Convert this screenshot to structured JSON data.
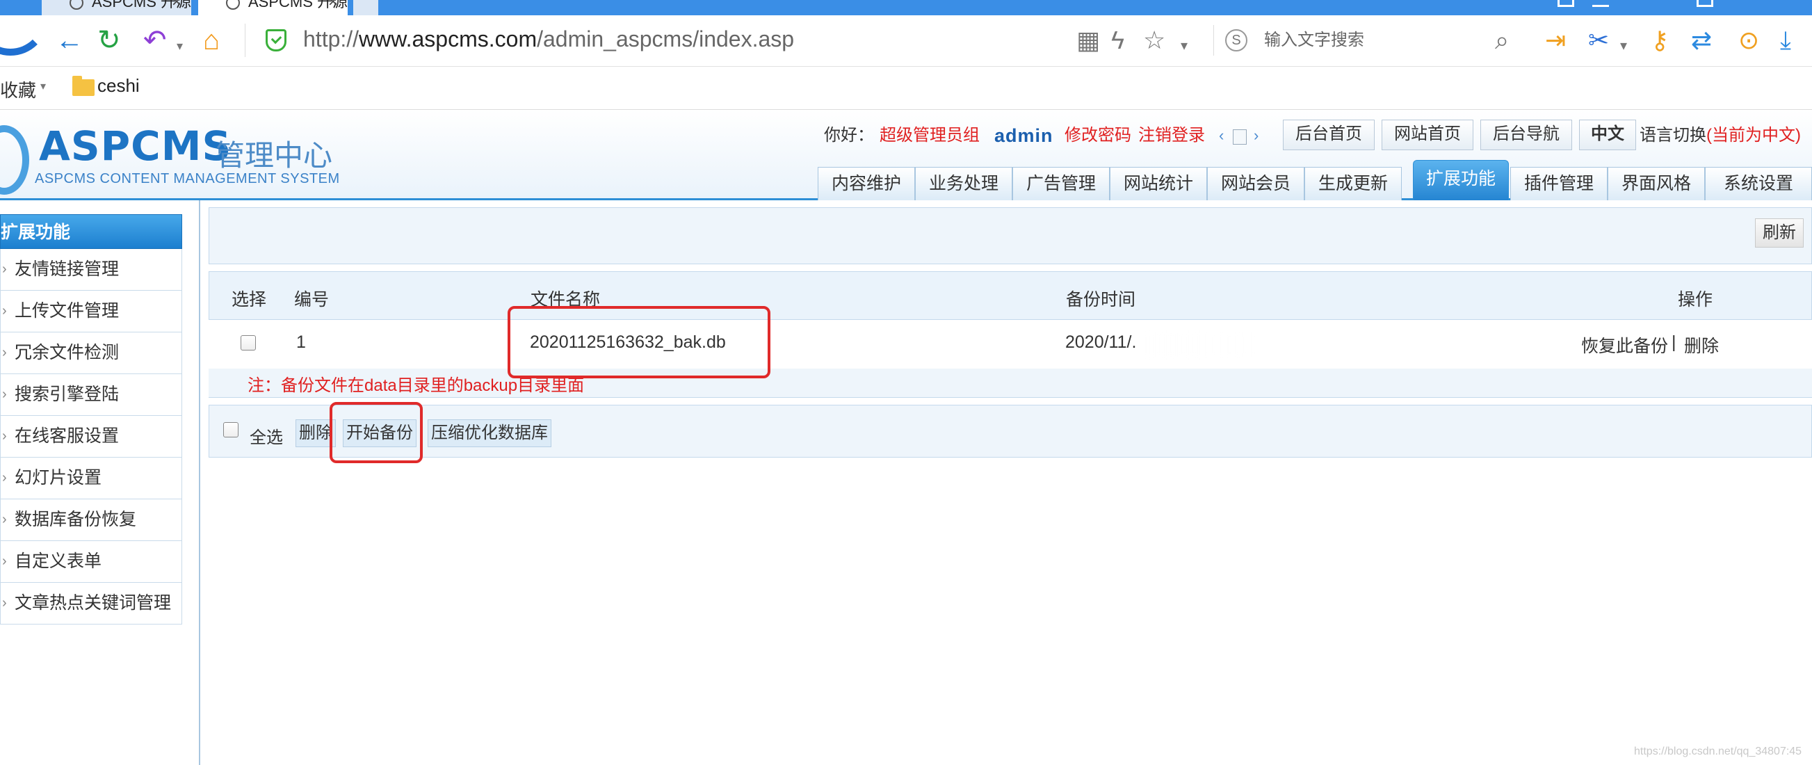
{
  "browser": {
    "tabs": [
      {
        "label": "ASPCMS 开源网站管理"
      },
      {
        "label": "ASPCMS 开源网站管理"
      }
    ],
    "close_glyph": "×",
    "url_prefix": "http://",
    "url_host": "www.aspcms.com",
    "url_path": "/admin_aspcms/index.asp",
    "search_placeholder": "输入文字搜索",
    "bookmarks": {
      "favorites": "收藏",
      "folder": "ceshi"
    }
  },
  "cms": {
    "brand": "ASPCMS",
    "brand_cn": "管理中心",
    "brand_sub": "ASPCMS CONTENT MANAGEMENT SYSTEM",
    "greeting": "你好：",
    "role": "超级管理员组",
    "username": "admin",
    "change_password": "修改密码",
    "logout": "注销登录",
    "top_buttons": [
      "后台首页",
      "网站首页",
      "后台导航",
      "中文"
    ],
    "lang_switch": "语言切换",
    "lang_current": "(当前为中文)",
    "menu": [
      "内容维护",
      "业务处理",
      "广告管理",
      "网站统计",
      "网站会员",
      "生成更新",
      "扩展功能",
      "插件管理",
      "界面风格",
      "系统设置"
    ],
    "active_menu": "扩展功能"
  },
  "sidebar": {
    "title": "扩展功能",
    "items": [
      "友情链接管理",
      "上传文件管理",
      "冗余文件检测",
      "搜索引擎登陆",
      "在线客服设置",
      "幻灯片设置",
      "数据库备份恢复",
      "自定义表单",
      "文章热点关键词管理"
    ]
  },
  "content": {
    "refresh": "刷新",
    "columns": {
      "select": "选择",
      "number": "编号",
      "filename": "文件名称",
      "backup_time": "备份时间",
      "operation": "操作"
    },
    "rows": [
      {
        "number": "1",
        "filename": "20201125163632_bak.db",
        "backup_time": "2020/11/.",
        "restore": "恢复此备份",
        "sep": "|",
        "delete": "删除"
      }
    ],
    "note": "注：备份文件在data目录里的backup目录里面",
    "select_all": "全选",
    "actions": {
      "delete": "删除",
      "start_backup": "开始备份",
      "compact": "压缩优化数据库"
    }
  },
  "watermark": "https://blog.csdn.net/qq_34807:45"
}
